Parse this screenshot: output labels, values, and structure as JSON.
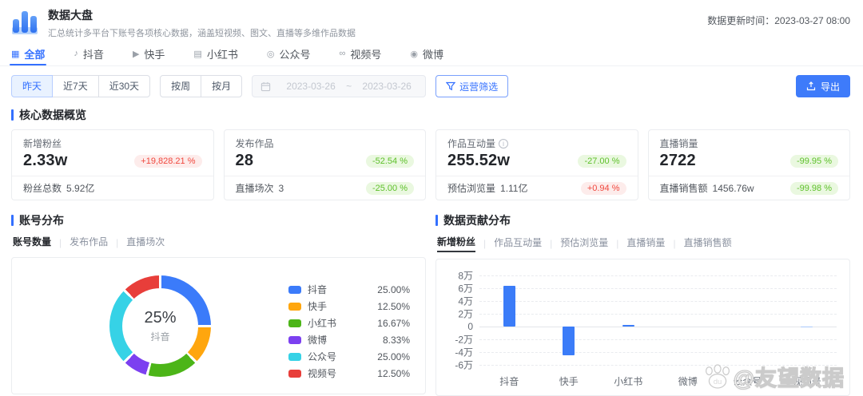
{
  "header": {
    "title": "数据大盘",
    "subtitle": "汇总统计多平台下账号各项核心数据，涵盖短视频、图文、直播等多维作品数据",
    "update_time": "数据更新时间：2023-03-27 08:00"
  },
  "tabs": [
    {
      "id": "all",
      "label": "全部",
      "icon": "grid-icon",
      "active": true
    },
    {
      "id": "douyin",
      "label": "抖音",
      "icon": "douyin-icon",
      "active": false
    },
    {
      "id": "kuaishou",
      "label": "快手",
      "icon": "kuaishou-icon",
      "active": false
    },
    {
      "id": "xiaohongshu",
      "label": "小红书",
      "icon": "xiaohongshu-icon",
      "active": false
    },
    {
      "id": "gongzhonghao",
      "label": "公众号",
      "icon": "gongzhonghao-icon",
      "active": false
    },
    {
      "id": "shipinhao",
      "label": "视频号",
      "icon": "shipinhao-icon",
      "active": false
    },
    {
      "id": "weibo",
      "label": "微博",
      "icon": "weibo-icon",
      "active": false
    }
  ],
  "filters": {
    "quick": [
      {
        "label": "昨天",
        "active": true
      },
      {
        "label": "近7天",
        "active": false
      },
      {
        "label": "近30天",
        "active": false
      }
    ],
    "period": [
      {
        "label": "按周",
        "active": false
      },
      {
        "label": "按月",
        "active": false
      }
    ],
    "date_range": {
      "start": "2023-03-26",
      "separator": "~",
      "end": "2023-03-26"
    },
    "ops_filter_label": "运营筛选",
    "export_label": "导出"
  },
  "overview": {
    "section_title": "核心数据概览",
    "cards": [
      {
        "label": "新增粉丝",
        "has_info": false,
        "value": "2.33w",
        "badge": "+19,828.21 %",
        "badge_type": "up",
        "footer_label": "粉丝总数",
        "footer_value": "5.92亿",
        "footer_badge": null,
        "footer_badge_type": null
      },
      {
        "label": "发布作品",
        "has_info": false,
        "value": "28",
        "badge": "-52.54 %",
        "badge_type": "down",
        "footer_label": "直播场次",
        "footer_value": "3",
        "footer_badge": "-25.00 %",
        "footer_badge_type": "down"
      },
      {
        "label": "作品互动量",
        "has_info": true,
        "value": "255.52w",
        "badge": "-27.00 %",
        "badge_type": "down",
        "footer_label": "预估浏览量",
        "footer_value": "1.11亿",
        "footer_badge": "+0.94 %",
        "footer_badge_type": "up"
      },
      {
        "label": "直播销量",
        "has_info": false,
        "value": "2722",
        "badge": "-99.95 %",
        "badge_type": "down",
        "footer_label": "直播销售额",
        "footer_value": "1456.76w",
        "footer_badge": "-99.98 %",
        "footer_badge_type": "down"
      }
    ]
  },
  "account_dist": {
    "section_title": "账号分布",
    "tabs": [
      {
        "label": "账号数量",
        "active": true
      },
      {
        "label": "发布作品",
        "active": false
      },
      {
        "label": "直播场次",
        "active": false
      }
    ]
  },
  "contribution": {
    "section_title": "数据贡献分布",
    "tabs": [
      {
        "label": "新增粉丝",
        "active": true
      },
      {
        "label": "作品互动量",
        "active": false
      },
      {
        "label": "预估浏览量",
        "active": false
      },
      {
        "label": "直播销量",
        "active": false
      },
      {
        "label": "直播销售额",
        "active": false
      }
    ]
  },
  "watermark": {
    "icon_text": "du",
    "text": "@友望数据"
  },
  "chart_data": [
    {
      "type": "pie",
      "title": "账号分布 - 账号数量",
      "donut": true,
      "labels": [
        "抖音",
        "快手",
        "小红书",
        "微博",
        "公众号",
        "视频号"
      ],
      "values": [
        25.0,
        12.5,
        16.67,
        8.33,
        25.0,
        12.5
      ],
      "value_labels": [
        "25.00%",
        "12.50%",
        "16.67%",
        "8.33%",
        "25.00%",
        "12.50%"
      ],
      "colors": [
        "#3b7bfa",
        "#ffa60e",
        "#4cb518",
        "#7c40f0",
        "#36d2e6",
        "#e83e3a"
      ],
      "center_value": "25%",
      "center_label": "抖音",
      "legend_position": "right"
    },
    {
      "type": "bar",
      "title": "数据贡献分布 - 新增粉丝",
      "categories": [
        "抖音",
        "快手",
        "小红书",
        "微博",
        "公众号",
        "视频号"
      ],
      "values": [
        64000,
        -45000,
        2000,
        0,
        0,
        500
      ],
      "bar_color": "#3b7cf8",
      "colors": [
        "#3b7cf8",
        "#3b7cf8",
        "#3b7cf8",
        "#3b7cf8",
        "#3b7cf8",
        "#a9c8fb"
      ],
      "ytick_labels": [
        "8万",
        "6万",
        "4万",
        "2万",
        "0",
        "-2万",
        "-4万",
        "-6万"
      ],
      "ytick_values": [
        80000,
        60000,
        40000,
        20000,
        0,
        -20000,
        -40000,
        -60000
      ],
      "ylim": [
        -68000,
        88000
      ],
      "grid": "dashed",
      "xlabel": "",
      "ylabel": "新增粉丝"
    }
  ]
}
